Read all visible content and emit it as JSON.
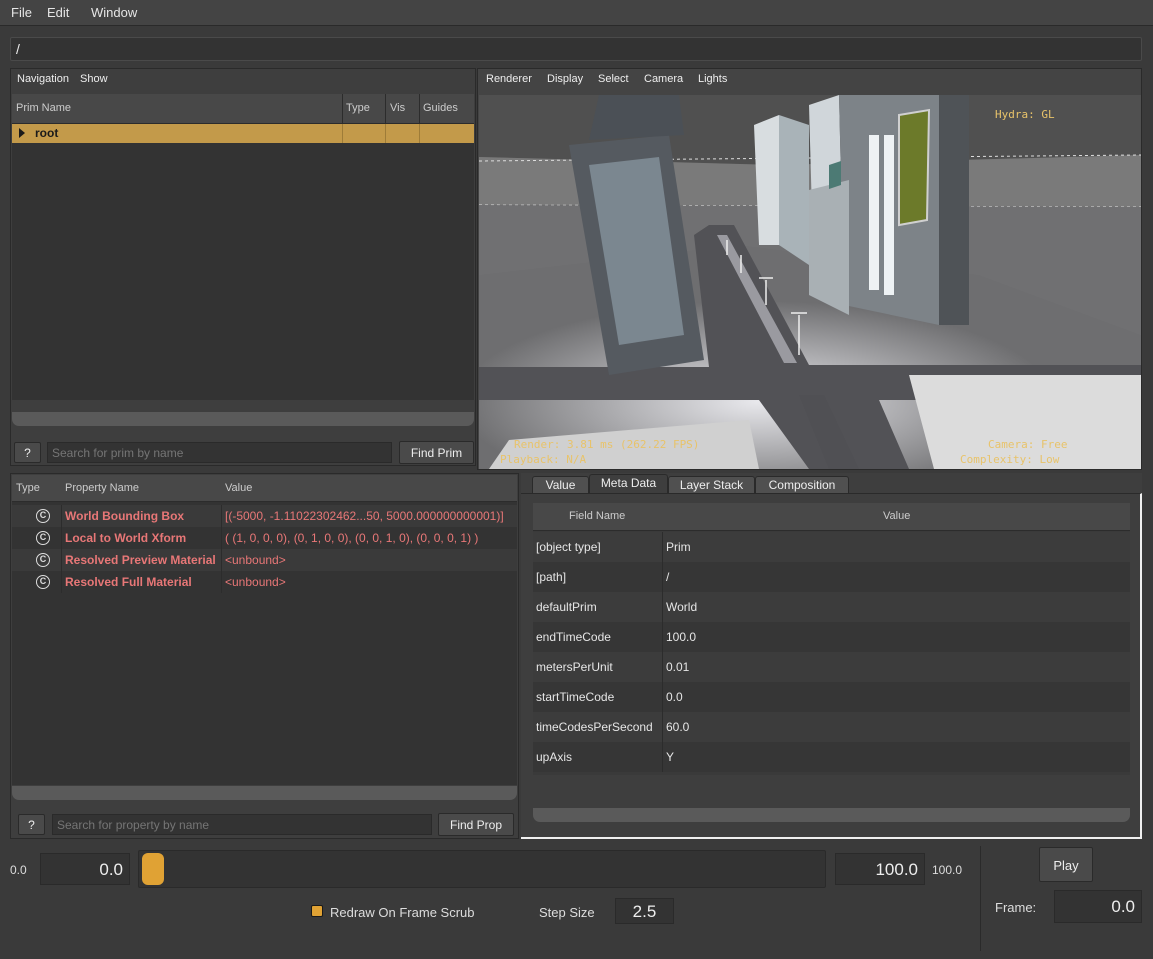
{
  "menubar": {
    "file": "File",
    "edit": "Edit",
    "window": "Window"
  },
  "path": "/",
  "navigation": {
    "menu_navigation": "Navigation",
    "menu_show": "Show",
    "columns": [
      "Prim Name",
      "Type",
      "Vis",
      "Guides"
    ],
    "root_label": "root",
    "help_label": "?",
    "search_placeholder": "Search for prim by name",
    "find_label": "Find Prim"
  },
  "viewport": {
    "menus": [
      "Renderer",
      "Display",
      "Select",
      "Camera",
      "Lights"
    ],
    "hud_hydra": "Hydra: GL",
    "hud_render": "Render: 3.81 ms (262.22 FPS)",
    "hud_playback": "Playback: N/A",
    "hud_camera": "Camera: Free",
    "hud_complexity": "Complexity: Low"
  },
  "properties": {
    "columns": [
      "Type",
      "Property Name",
      "Value"
    ],
    "type_icon": "C",
    "rows": [
      {
        "name": "World Bounding Box",
        "value": "[(-5000, -1.11022302462...50, 5000.000000000001)]"
      },
      {
        "name": "Local to World Xform",
        "value": "( (1, 0, 0, 0), (0, 1, 0, 0), (0, 0, 1, 0), (0, 0, 0, 1) )"
      },
      {
        "name": "Resolved Preview Material",
        "value": "<unbound>"
      },
      {
        "name": "Resolved Full Material",
        "value": "<unbound>"
      }
    ],
    "help_label": "?",
    "search_placeholder": "Search for property by name",
    "find_label": "Find Prop"
  },
  "metadata": {
    "tabs": [
      "Value",
      "Meta Data",
      "Layer Stack",
      "Composition"
    ],
    "active_tab": "Meta Data",
    "columns": [
      "Field Name",
      "Value"
    ],
    "rows": [
      {
        "field": "[object type]",
        "value": "Prim"
      },
      {
        "field": "[path]",
        "value": "/"
      },
      {
        "field": "defaultPrim",
        "value": "World"
      },
      {
        "field": "endTimeCode",
        "value": "100.0"
      },
      {
        "field": "metersPerUnit",
        "value": "0.01"
      },
      {
        "field": "startTimeCode",
        "value": "0.0"
      },
      {
        "field": "timeCodesPerSecond",
        "value": "60.0"
      },
      {
        "field": "upAxis",
        "value": "Y"
      }
    ]
  },
  "timeline": {
    "range_start_label": "0.0",
    "start_value": "0.0",
    "end_value": "100.0",
    "range_end_label": "100.0",
    "play_label": "Play",
    "redraw_label": "Redraw On Frame Scrub",
    "step_size_label": "Step Size",
    "step_size_value": "2.5",
    "frame_label": "Frame:",
    "frame_value": "0.0"
  },
  "colors": {
    "accent": "#e0a234",
    "selection": "#c39a4a",
    "property_text": "#e87777",
    "hud_text": "#e8c36a"
  }
}
